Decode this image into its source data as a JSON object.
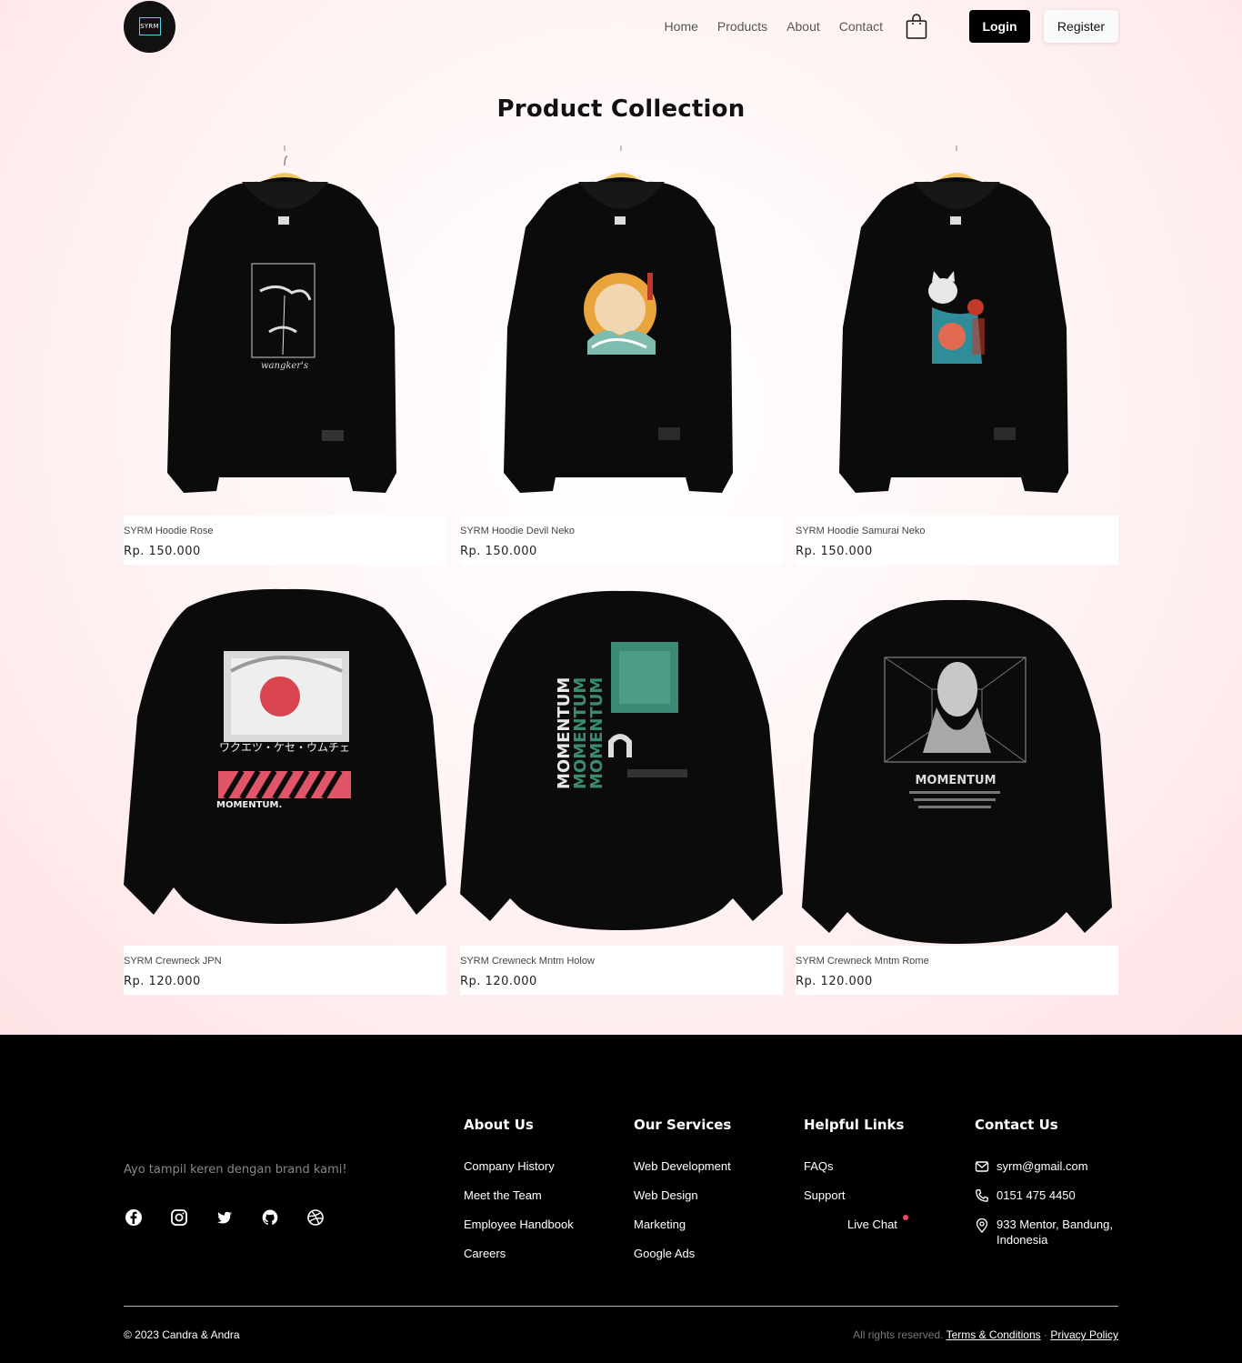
{
  "header": {
    "logo_text": "SYRM",
    "nav": [
      "Home",
      "Products",
      "About",
      "Contact"
    ],
    "login_label": "Login",
    "register_label": "Register"
  },
  "main": {
    "title": "Product Collection",
    "products": [
      {
        "name": "SYRM Hoodie Rose",
        "price": "Rp. 150.000"
      },
      {
        "name": "SYRM Hoodie Devil Neko",
        "price": "Rp. 150.000"
      },
      {
        "name": "SYRM Hoodie Samurai Neko",
        "price": "Rp. 150.000"
      },
      {
        "name": "SYRM Crewneck JPN",
        "price": "Rp. 120.000"
      },
      {
        "name": "SYRM Crewneck Mntm Holow",
        "price": "Rp. 120.000"
      },
      {
        "name": "SYRM Crewneck Mntm Rome",
        "price": "Rp. 120.000"
      }
    ],
    "print_text": {
      "rose": "wangker's",
      "jpn_kana": "ワクエツ・ケセ・ウムチェ",
      "jpn_brand": "MOMENTUM.",
      "holow_word": "MOMENTUM",
      "rome_word": "MOMENTUM"
    }
  },
  "footer": {
    "tagline": "Ayo tampil keren dengan brand kami!",
    "socials": [
      "facebook-icon",
      "instagram-icon",
      "twitter-icon",
      "github-icon",
      "dribbble-icon"
    ],
    "about": {
      "heading": "About Us",
      "links": [
        "Company History",
        "Meet the Team",
        "Employee Handbook",
        "Careers"
      ]
    },
    "services": {
      "heading": "Our Services",
      "links": [
        "Web Development",
        "Web Design",
        "Marketing",
        "Google Ads"
      ]
    },
    "helpful": {
      "heading": "Helpful Links",
      "links": [
        "FAQs",
        "Support",
        "Live Chat"
      ]
    },
    "contact": {
      "heading": "Contact Us",
      "email": "syrm@gmail.com",
      "phone": "0151 475 4450",
      "address_line1": "933 Mentor, Bandung,",
      "address_line2": "Indonesia"
    },
    "copyright": "© 2023 Candra & Andra",
    "rights": "All rights reserved.",
    "terms": "Terms & Conditions",
    "separator": "·",
    "privacy": "Privacy Policy"
  },
  "colors": {
    "accent": "#ef4560",
    "logo_border": "#4fd6e8",
    "footer_bg": "#000000"
  }
}
